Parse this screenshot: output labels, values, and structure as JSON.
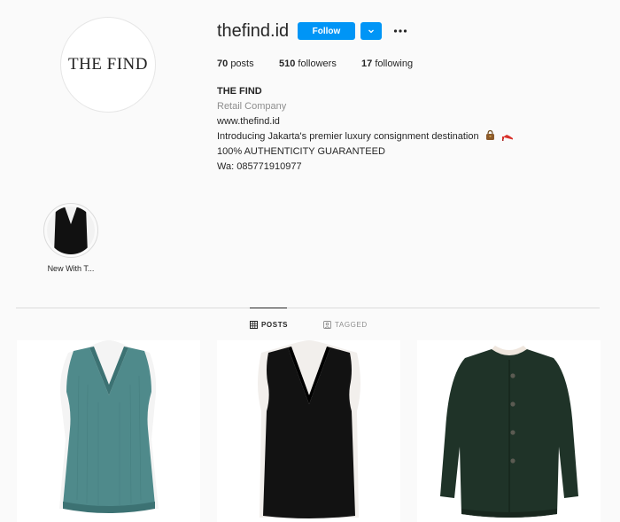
{
  "profile": {
    "avatar_text": "THE FIND",
    "username": "thefind.id",
    "follow_label": "Follow",
    "dropdown_icon": "chevron-down-icon",
    "more_icon": "ellipsis-icon"
  },
  "stats": {
    "posts_count": "70",
    "posts_label": "posts",
    "followers_count": "510",
    "followers_label": "followers",
    "following_count": "17",
    "following_label": "following"
  },
  "bio": {
    "name": "THE FIND",
    "category": "Retail Company",
    "website": "www.thefind.id",
    "line1": "Introducing Jakarta's premier luxury consignment destination",
    "line2": "100% AUTHENTICITY GUARANTEED",
    "line3": "Wa: 085771910977",
    "emojis": [
      "handbag-emoji",
      "high-heel-emoji"
    ]
  },
  "highlights": [
    {
      "label": "New With T..."
    }
  ],
  "tabs": {
    "posts_label": "POSTS",
    "tagged_label": "TAGGED"
  },
  "colors": {
    "accent": "#0095f6",
    "background": "#fafafa",
    "secondary_text": "#8e8e8e",
    "divider": "#dbdbdb"
  },
  "posts": [
    {
      "item": "teal knit v-neck sleeveless top"
    },
    {
      "item": "black v-neck sleeveless top"
    },
    {
      "item": "dark green buttoned cardigan"
    }
  ]
}
